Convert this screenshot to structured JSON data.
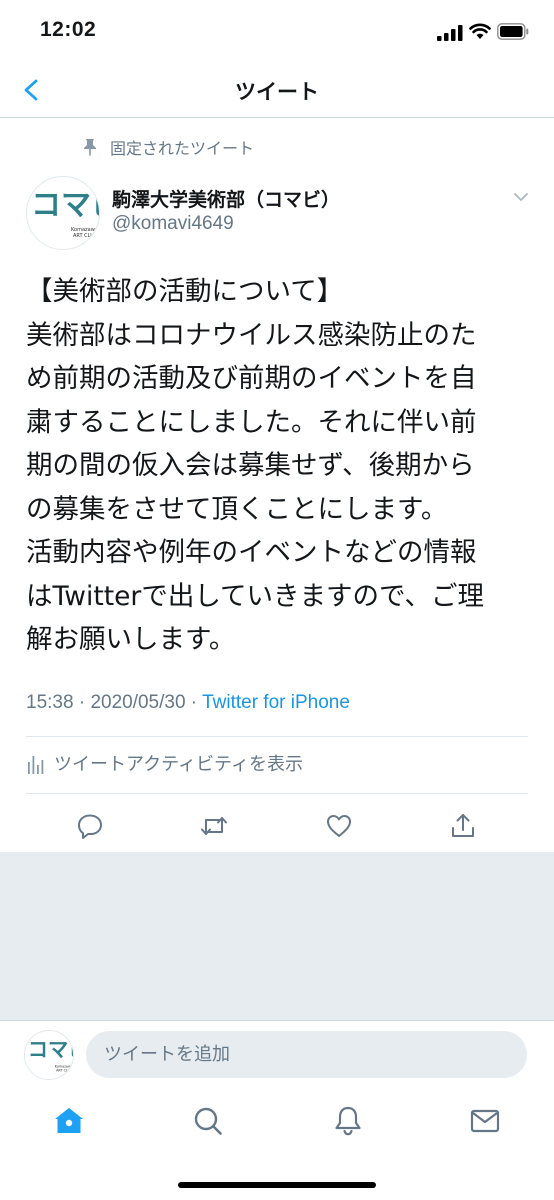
{
  "status_bar": {
    "time": "12:02"
  },
  "nav": {
    "title": "ツイート"
  },
  "tweet": {
    "pinned_label": "固定されたツイート",
    "display_name": "駒澤大学美術部（コマビ）",
    "handle": "@komavi4649",
    "body_lines": [
      "【美術部の活動について】",
      "美術部はコロナウイルス感染防止のた",
      "め前期の活動及び前期のイベントを自",
      "粛することにしました。それに伴い前",
      "期の間の仮入会は募集せず、後期から",
      "の募集をさせて頂くことにします。",
      "活動内容や例年のイベントなどの情報",
      "はTwitterで出していきますので、ご理",
      "解お願いします。"
    ],
    "time": "15:38",
    "separator": " · ",
    "date": "2020/05/30",
    "source": "Twitter for iPhone",
    "activity_label": "ツイートアクティビティを表示"
  },
  "avatar": {
    "text_main": "コマビ",
    "text_small": "Komazawa ART CLUB"
  },
  "compose": {
    "placeholder": "ツイートを追加"
  },
  "colors": {
    "accent": "#1da1f2",
    "link": "#1b95e0",
    "secondary_text": "#657786",
    "gray_bg": "#e6ecf0",
    "avatar_teal": "#2f7f8a"
  },
  "icons": {
    "actions": [
      "reply-icon",
      "retweet-icon",
      "like-icon",
      "share-icon"
    ],
    "tabs": [
      "home-icon",
      "search-icon",
      "notifications-icon",
      "messages-icon"
    ]
  }
}
